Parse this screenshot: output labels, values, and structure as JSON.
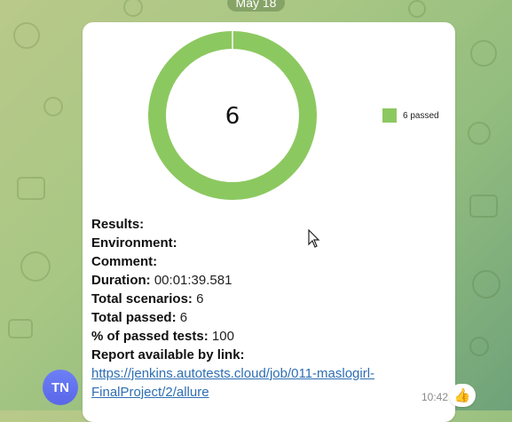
{
  "header": {
    "date": "May 18"
  },
  "chart_data": {
    "type": "pie",
    "categories": [
      "passed"
    ],
    "values": [
      6
    ],
    "center_label": "6",
    "legend": [
      "6 passed"
    ],
    "colors": [
      "#8cc860"
    ]
  },
  "message": {
    "results_label": "Results:",
    "environment_label": "Environment:",
    "comment_label": "Comment:",
    "duration_label": "Duration:",
    "duration_value": "00:01:39.581",
    "total_scenarios_label": "Total scenarios:",
    "total_scenarios_value": "6",
    "total_passed_label": "Total passed:",
    "total_passed_value": "6",
    "percent_label": "% of passed tests:",
    "percent_value": "100",
    "report_label": "Report available by link:",
    "link_line1": "https://jenkins.autotests.cloud/job/011-maslogirl-",
    "link_line2": "FinalProject/2/allure",
    "time": "10:42"
  },
  "avatar": {
    "initials": "TN"
  },
  "reaction": {
    "icon": "thumbs-up-icon",
    "glyph": "👍"
  },
  "colors": {
    "accent": "#8cc860",
    "link": "#2e6eb3",
    "avatar": "#6d7ff5"
  }
}
